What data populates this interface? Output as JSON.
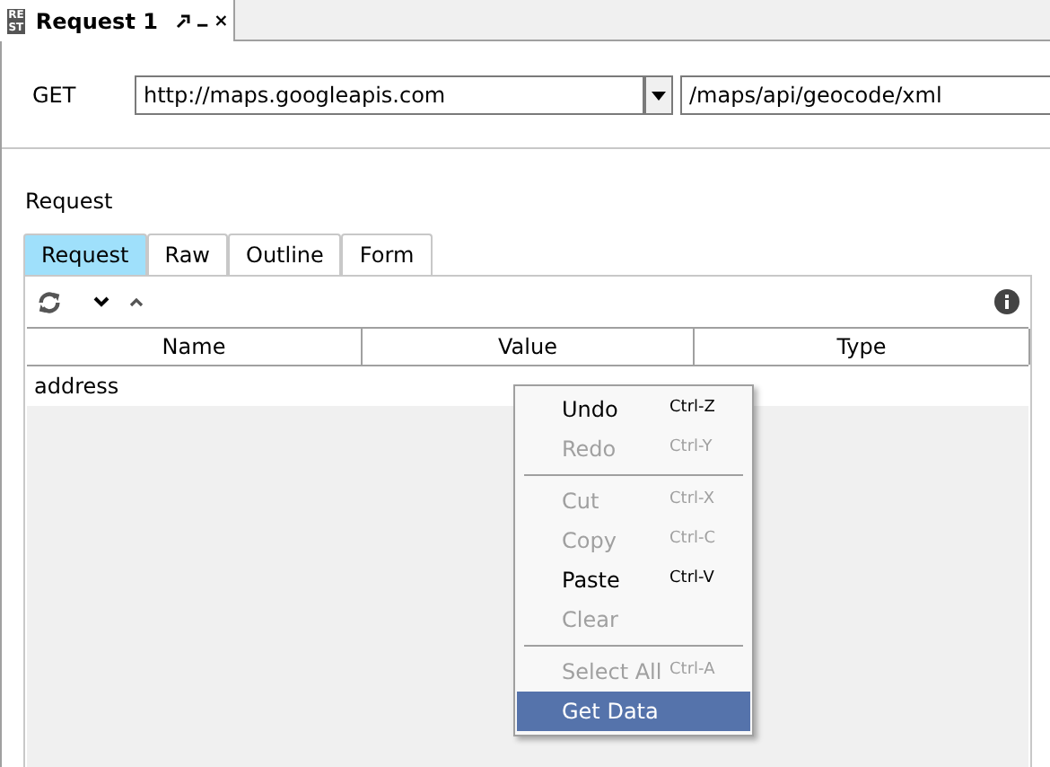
{
  "document_tab": {
    "title": "Request 1",
    "icon_text": "RE ST"
  },
  "request_line": {
    "method": "GET",
    "host": "http://maps.googleapis.com",
    "path": "/maps/api/geocode/xml"
  },
  "section_label": "Request",
  "tabs": [
    {
      "label": "Request",
      "selected": true
    },
    {
      "label": "Raw",
      "selected": false
    },
    {
      "label": "Outline",
      "selected": false
    },
    {
      "label": "Form",
      "selected": false
    }
  ],
  "table": {
    "columns": [
      "Name",
      "Value",
      "Type"
    ],
    "rows": [
      {
        "name": "address"
      }
    ]
  },
  "context_menu": [
    {
      "kind": "item",
      "label": "Undo",
      "shortcut": "Ctrl-Z",
      "disabled": false,
      "selected": false
    },
    {
      "kind": "item",
      "label": "Redo",
      "shortcut": "Ctrl-Y",
      "disabled": true,
      "selected": false
    },
    {
      "kind": "separator"
    },
    {
      "kind": "item",
      "label": "Cut",
      "shortcut": "Ctrl-X",
      "disabled": true,
      "selected": false
    },
    {
      "kind": "item",
      "label": "Copy",
      "shortcut": "Ctrl-C",
      "disabled": true,
      "selected": false
    },
    {
      "kind": "item",
      "label": "Paste",
      "shortcut": "Ctrl-V",
      "disabled": false,
      "selected": false
    },
    {
      "kind": "item",
      "label": "Clear",
      "disabled": true,
      "selected": false
    },
    {
      "kind": "separator"
    },
    {
      "kind": "item",
      "label": "Select All",
      "shortcut": "Ctrl-A",
      "disabled": true,
      "selected": false
    },
    {
      "kind": "item",
      "label": "Get Data",
      "disabled": false,
      "selected": true
    }
  ]
}
